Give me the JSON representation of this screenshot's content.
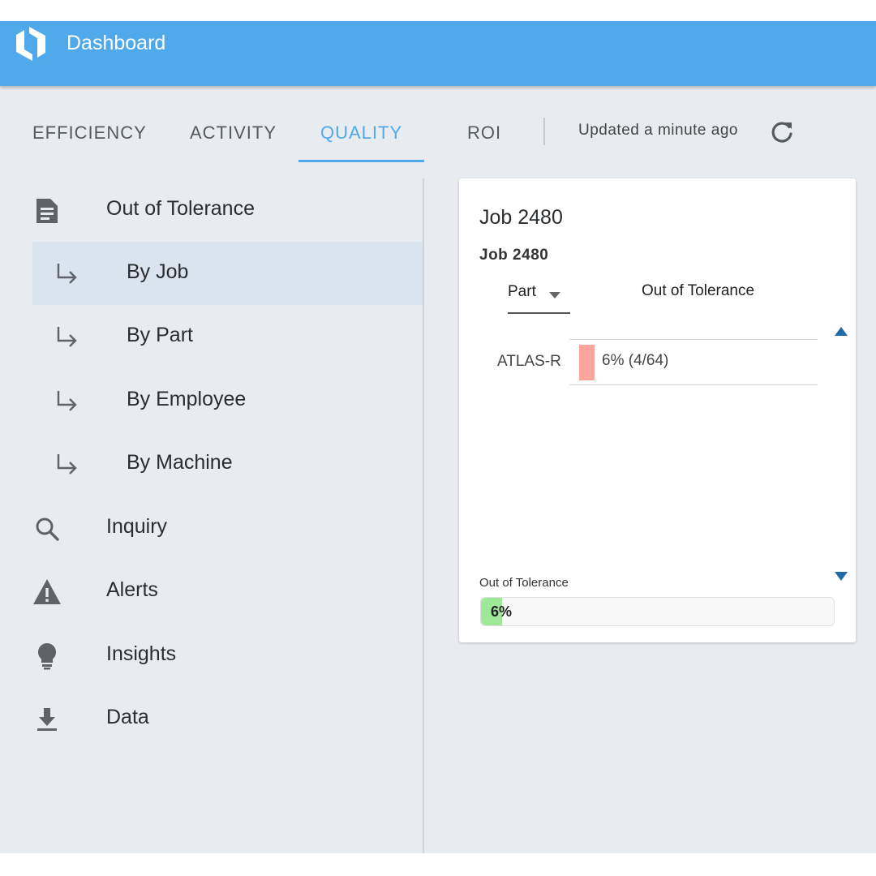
{
  "app": {
    "title": "Dashboard",
    "brand_color": "#4fa9ea"
  },
  "tabs": [
    {
      "label": "EFFICIENCY",
      "active": false
    },
    {
      "label": "ACTIVITY",
      "active": false
    },
    {
      "label": "QUALITY",
      "active": true
    },
    {
      "label": "ROI",
      "active": false
    }
  ],
  "status": {
    "updated": "Updated a minute ago",
    "refresh_icon": "refresh-icon"
  },
  "sidebar": {
    "out_of_tolerance": {
      "label": "Out of Tolerance",
      "icon": "document-icon"
    },
    "sub_items": [
      {
        "label": "By Job",
        "selected": true,
        "icon": "subdirectory-arrow-icon"
      },
      {
        "label": "By Part",
        "selected": false,
        "icon": "subdirectory-arrow-icon"
      },
      {
        "label": "By Employee",
        "selected": false,
        "icon": "subdirectory-arrow-icon"
      },
      {
        "label": "By Machine",
        "selected": false,
        "icon": "subdirectory-arrow-icon"
      }
    ],
    "items": [
      {
        "label": "Inquiry",
        "icon": "search-icon"
      },
      {
        "label": "Alerts",
        "icon": "warning-icon"
      },
      {
        "label": "Insights",
        "icon": "lightbulb-icon"
      },
      {
        "label": "Data",
        "icon": "download-icon"
      }
    ]
  },
  "card": {
    "title": "Job 2480",
    "subtitle": "Job 2480",
    "columns": {
      "part": "Part",
      "out_of_tolerance": "Out of Tolerance"
    },
    "rows": [
      {
        "part": "ATLAS-R",
        "value_text": "6% (4/64)",
        "fraction": 0.0625,
        "bar_color": "#fba59e"
      }
    ],
    "summary": {
      "label": "Out of Tolerance",
      "value_text": "6%",
      "fraction": 0.06,
      "fill_color": "#9fe89a"
    }
  }
}
